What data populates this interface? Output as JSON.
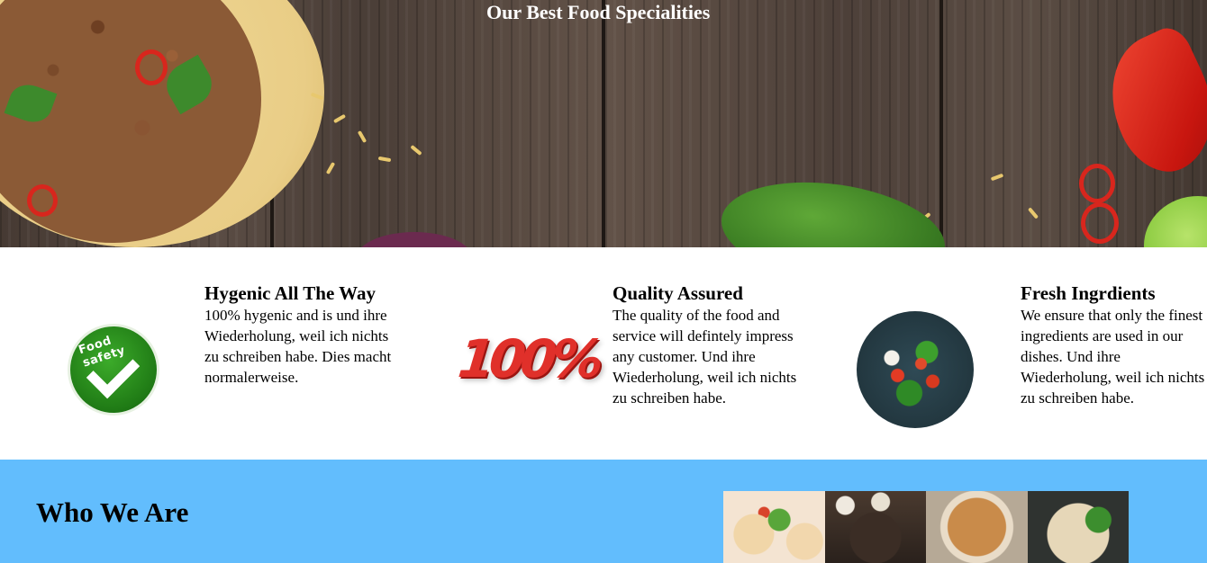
{
  "hero": {
    "title": "Our Best Food Specialities"
  },
  "features": [
    {
      "title": "Hygenic All The Way",
      "text": "100% hygenic and is und ihre Wiederholung, weil ich nichts zu schreiben habe. Dies macht normalerweise.",
      "icon": "food-safety-badge-icon",
      "icon_text": "Food safety"
    },
    {
      "title": "Quality Assured",
      "text": "The quality of the food and service will defintely impress any customer. Und ihre Wiederholung, weil ich nichts zu schreiben habe.",
      "icon": "hundred-percent-icon",
      "icon_text": "100%"
    },
    {
      "title": "Fresh Ingrdients",
      "text": "We ensure that only the finest ingredients are used in our dishes. Und ihre Wiederholung, weil ich nichts zu schreiben habe.",
      "icon": "fresh-vegetables-icon"
    }
  ],
  "who": {
    "title": "Who We Are",
    "gallery": [
      "dumplings-photo",
      "grill-photo",
      "rice-dish-photo",
      "noodle-soup-photo"
    ]
  },
  "colors": {
    "who_bg": "#62bdfd",
    "feature_bg": "#ffffff",
    "hero_wood": "#4f423a"
  }
}
